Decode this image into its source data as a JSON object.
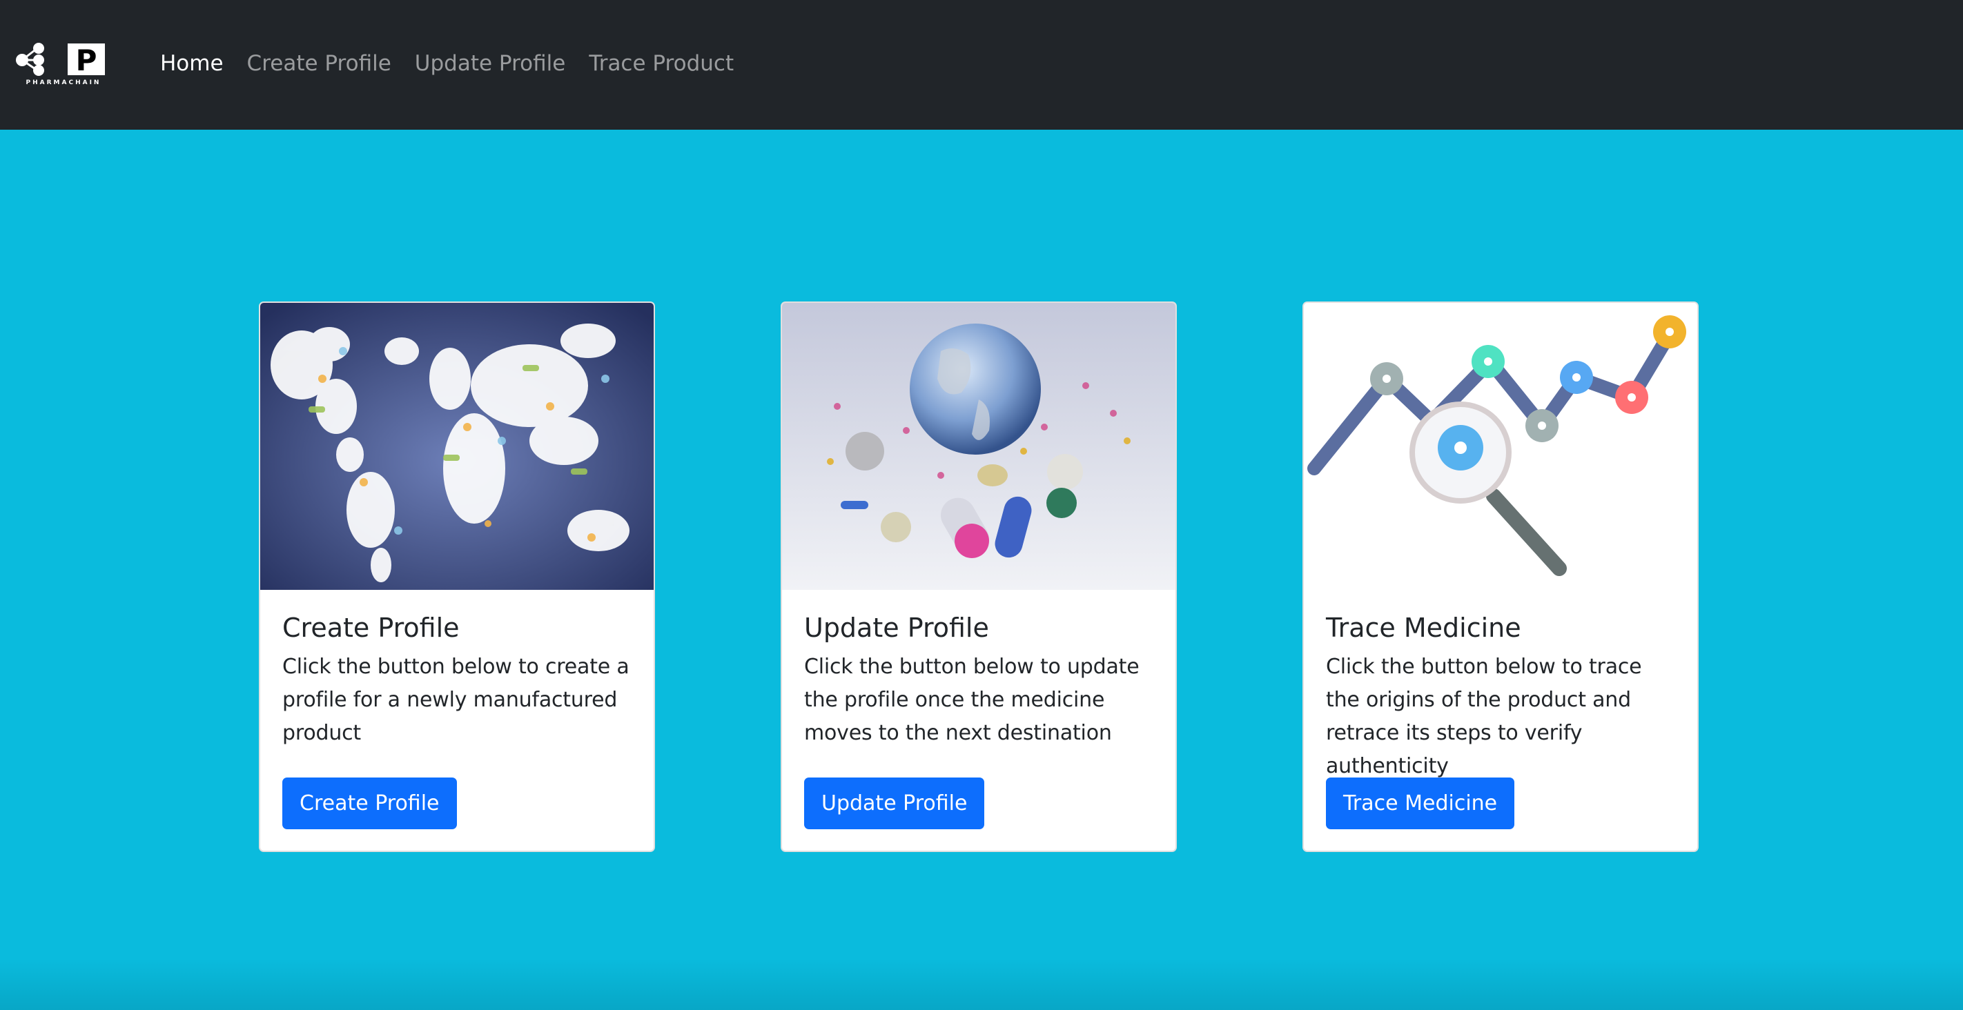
{
  "navbar": {
    "brand_name": "PHARMACHAIN",
    "brand_letter": "P",
    "links": [
      {
        "label": "Home",
        "active": true
      },
      {
        "label": "Create Profile",
        "active": false
      },
      {
        "label": "Update Profile",
        "active": false
      },
      {
        "label": "Trace Product",
        "active": false
      }
    ]
  },
  "cards": [
    {
      "title": "Create Profile",
      "text": "Click the button below to create a profile for a newly manufactured product",
      "button": "Create Profile",
      "image": "world-map-of-pills-image"
    },
    {
      "title": "Update Profile",
      "text": "Click the button below to update the profile once the medicine moves to the next destination",
      "button": "Update Profile",
      "image": "globe-with-pills-image"
    },
    {
      "title": "Trace Medicine",
      "text": "Click the button below to trace the origins of the product and retrace its steps to verify authenticity",
      "button": "Trace Medicine",
      "image": "trace-magnifier-graph-image"
    }
  ],
  "colors": {
    "page_background": "#0abbdd",
    "navbar_background": "#212529",
    "button_primary": "#0d6efd"
  }
}
